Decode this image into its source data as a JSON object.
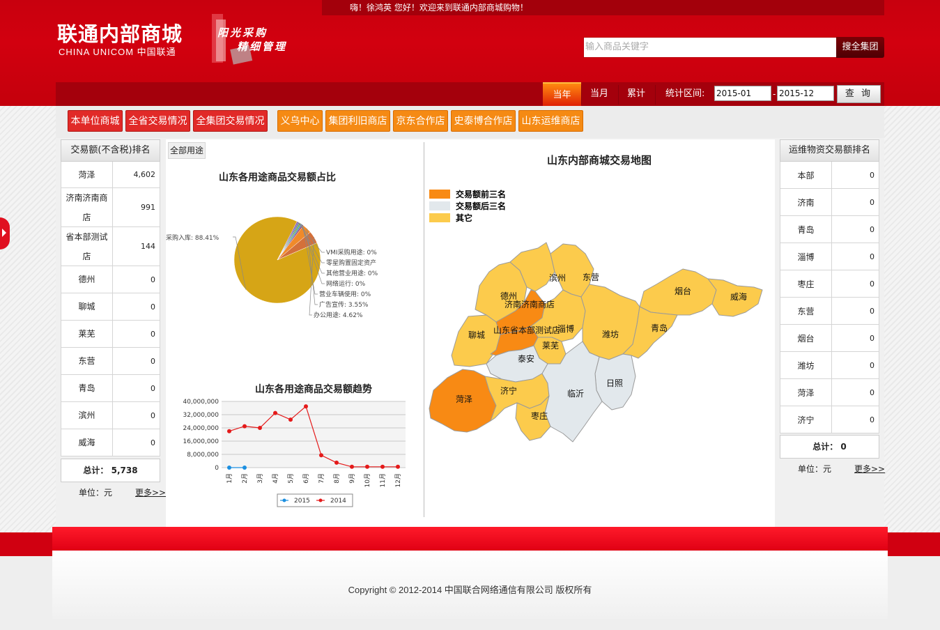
{
  "header": {
    "greeting": "嗨！徐鸿英  您好！欢迎来到联通内部商城购物！",
    "logo_title": "联通内部商城",
    "logo_subtitle": "CHINA UNICOM 中国联通",
    "slogan_line1": "阳光采购",
    "slogan_line2": "精细管理",
    "search_placeholder": "输入商品关键字",
    "search_button": "搜全集团"
  },
  "nav": {
    "tabs": [
      "当年",
      "当月",
      "累计"
    ],
    "active_tab": "当年",
    "range_label": "统计区间:",
    "date_from": "2015-01",
    "date_sep": "-",
    "date_to": "2015-12",
    "query_button": "查 询"
  },
  "shops": {
    "red": [
      "本单位商城",
      "全省交易情况",
      "全集团交易情况"
    ],
    "orange": [
      "义乌中心",
      "集团利旧商店",
      "京东合作店",
      "史泰博合作店",
      "山东运维商店"
    ]
  },
  "left_ranking": {
    "title": "交易额(不含税)排名",
    "rows": [
      {
        "name": "菏泽",
        "value": "4,602"
      },
      {
        "name": "济南济南商店",
        "value": "991"
      },
      {
        "name": "省本部测试店",
        "value": "144"
      },
      {
        "name": "德州",
        "value": "0"
      },
      {
        "name": "聊城",
        "value": "0"
      },
      {
        "name": "莱芜",
        "value": "0"
      },
      {
        "name": "东营",
        "value": "0"
      },
      {
        "name": "青岛",
        "value": "0"
      },
      {
        "name": "滨州",
        "value": "0"
      },
      {
        "name": "威海",
        "value": "0"
      }
    ],
    "total_label": "总计：",
    "total_value": "5,738",
    "unit": "单位：元",
    "more": "更多>>"
  },
  "center": {
    "filter_button": "全部用途",
    "pie_title": "山东各用途商品交易额占比",
    "line_title": "山东各用途商品交易额趋势",
    "map_title": "山东内部商城交易地图"
  },
  "chart_data": [
    {
      "type": "pie",
      "title": "山东各用途商品交易额占比",
      "slices": [
        {
          "label": "采购入库",
          "value": 88.41,
          "text": "采购入库: 88.41%",
          "color": "#d6a516"
        },
        {
          "label": "VMI采购用途",
          "value": 0,
          "text": "VMI采购用途: 0%",
          "color": "#7a4aa8"
        },
        {
          "label": "零星购置固定资产",
          "value": 0,
          "text": "零星购置固定资产",
          "color": "#4a6aa8"
        },
        {
          "label": "其他营业用途",
          "value": 0,
          "text": "其他营业用途: 0%",
          "color": "#6a9a2a"
        },
        {
          "label": "网络运行",
          "value": 0,
          "text": "网络运行: 0%",
          "color": "#2a8ab8"
        },
        {
          "label": "营业车辆使用",
          "value": 0,
          "text": "营业车辆使用: 0%",
          "color": "#8a2a6a"
        },
        {
          "label": "广告宣传",
          "value": 3.55,
          "text": "广告宣传: 3.55%",
          "color": "#f08a2a"
        },
        {
          "label": "办公用途",
          "value": 4.62,
          "text": "办公用途: 4.62%",
          "color": "#d4703a"
        }
      ]
    },
    {
      "type": "line",
      "title": "山东各用途商品交易额趋势",
      "categories": [
        "1月",
        "2月",
        "3月",
        "4月",
        "5月",
        "6月",
        "7月",
        "8月",
        "9月",
        "10月",
        "11月",
        "12月"
      ],
      "yticks": [
        "40,000,000",
        "32,000,000",
        "24,000,000",
        "16,000,000",
        "8,000,000",
        "0"
      ],
      "ylim": [
        0,
        40000000
      ],
      "series": [
        {
          "name": "2015",
          "color": "#1c8fe0",
          "values": [
            0,
            0,
            null,
            null,
            null,
            null,
            null,
            null,
            null,
            null,
            null,
            null
          ]
        },
        {
          "name": "2014",
          "color": "#e41a1a",
          "values": [
            22000000,
            25000000,
            24000000,
            33000000,
            29000000,
            37000000,
            7500000,
            3000000,
            500000,
            500000,
            500000,
            500000
          ]
        }
      ]
    }
  ],
  "map": {
    "legend": [
      {
        "label": "交易额前三名",
        "color": "#f88a14"
      },
      {
        "label": "交易额后三名",
        "color": "#e2e8ec"
      },
      {
        "label": "其它",
        "color": "#fccb4c"
      }
    ],
    "regions": [
      "滨州",
      "东营",
      "德州",
      "济南济南商店",
      "烟台",
      "威海",
      "聊城",
      "山东省本部测试店",
      "淄博",
      "潍坊",
      "青岛",
      "莱芜",
      "泰安",
      "日照",
      "菏泽",
      "济宁",
      "临沂",
      "枣庄"
    ]
  },
  "right_ranking": {
    "title": "运维物资交易额排名",
    "rows": [
      {
        "name": "本部",
        "value": "0"
      },
      {
        "name": "济南",
        "value": "0"
      },
      {
        "name": "青岛",
        "value": "0"
      },
      {
        "name": "淄博",
        "value": "0"
      },
      {
        "name": "枣庄",
        "value": "0"
      },
      {
        "name": "东营",
        "value": "0"
      },
      {
        "name": "烟台",
        "value": "0"
      },
      {
        "name": "潍坊",
        "value": "0"
      },
      {
        "name": "菏泽",
        "value": "0"
      },
      {
        "name": "济宁",
        "value": "0"
      }
    ],
    "total_label": "总计：",
    "total_value": "0",
    "unit": "单位：元",
    "more": "更多>>"
  },
  "footer": {
    "copyright": "Copyright © 2012-2014  中国联合网络通信有限公司 版权所有"
  }
}
